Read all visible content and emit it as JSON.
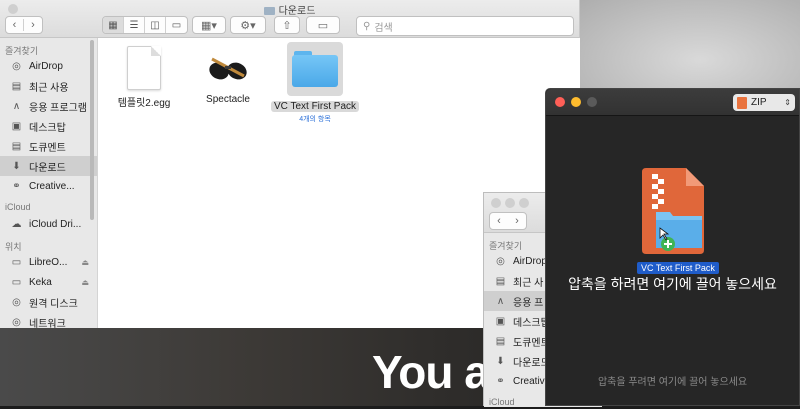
{
  "finder": {
    "title": "다운로드",
    "search_placeholder": "검색",
    "sidebar": {
      "favorites_header": "즐겨찾기",
      "items": [
        {
          "label": "AirDrop",
          "icon": "airdrop-icon"
        },
        {
          "label": "최근 사용",
          "icon": "recents-icon"
        },
        {
          "label": "응용 프로그램",
          "icon": "applications-icon"
        },
        {
          "label": "데스크탑",
          "icon": "desktop-icon"
        },
        {
          "label": "도큐멘트",
          "icon": "documents-icon"
        },
        {
          "label": "다운로드",
          "icon": "downloads-icon"
        },
        {
          "label": "Creative...",
          "icon": "creative-cloud-icon"
        }
      ],
      "icloud_header": "iCloud",
      "icloud_items": [
        {
          "label": "iCloud Dri...",
          "icon": "icloud-icon"
        }
      ],
      "locations_header": "위치",
      "location_items": [
        {
          "label": "LibreO...",
          "icon": "disk-icon"
        },
        {
          "label": "Keka",
          "icon": "disk-icon"
        },
        {
          "label": "원격 디스크",
          "icon": "remote-disc-icon"
        },
        {
          "label": "네트워크",
          "icon": "network-icon"
        }
      ]
    },
    "files": [
      {
        "name": "템플릿2.egg",
        "kind": "document"
      },
      {
        "name": "Spectacle",
        "kind": "app"
      },
      {
        "name": "VC Text First Pack",
        "kind": "folder",
        "subtitle": "4개의 항목"
      }
    ]
  },
  "finder2": {
    "favorites_header": "즐겨찾기",
    "items": [
      {
        "label": "AirDrop"
      },
      {
        "label": "최근 사"
      },
      {
        "label": "응용 프"
      },
      {
        "label": "데스크탑"
      },
      {
        "label": "도큐멘트"
      },
      {
        "label": "다운로드"
      },
      {
        "label": "Creativ"
      }
    ],
    "icloud_header": "iCloud"
  },
  "archiver": {
    "format": "ZIP",
    "dragged_item": "VC Text First Pack",
    "prompt": "압축을 하려면 여기에 끌어 놓으세요",
    "hint": "압축을 푸려면 여기에 끌어 놓으세요"
  },
  "background": {
    "headline": "You a"
  },
  "colors": {
    "accent": "#1f5cc9",
    "zip_orange": "#e9733e",
    "folder_blue": "#5db5ee"
  }
}
